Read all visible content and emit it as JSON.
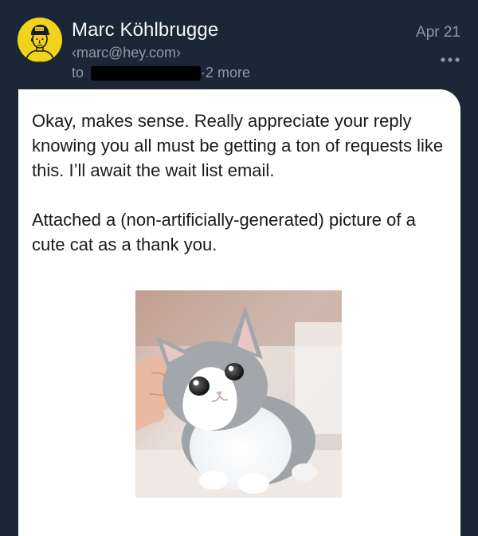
{
  "sender": {
    "name": "Marc Köhlbrugge",
    "email": "‹marc@hey.com›",
    "avatar_icon": "avatar-cartoon-portrait-icon",
    "avatar_color": "#f2d31b"
  },
  "recipients": {
    "to_label": "to",
    "separator": "·",
    "more_label": "2 more"
  },
  "date": "Apr 21",
  "more_options_icon": "ellipsis-icon",
  "body": {
    "paragraph_1": "Okay, makes sense. Really appreciate your reply knowing you all must be getting a ton of requests like this. I’ll await the wait list email.",
    "paragraph_2": "Attached a (non-artificially-generated) picture of a cute cat as a thank you."
  },
  "attachment": {
    "type": "image",
    "subject": "kitten-photo"
  },
  "colors": {
    "header_background": "#1b2736",
    "card_background": "#ffffff",
    "muted_text": "#8e99a6",
    "name_text": "#f4f6f8"
  }
}
